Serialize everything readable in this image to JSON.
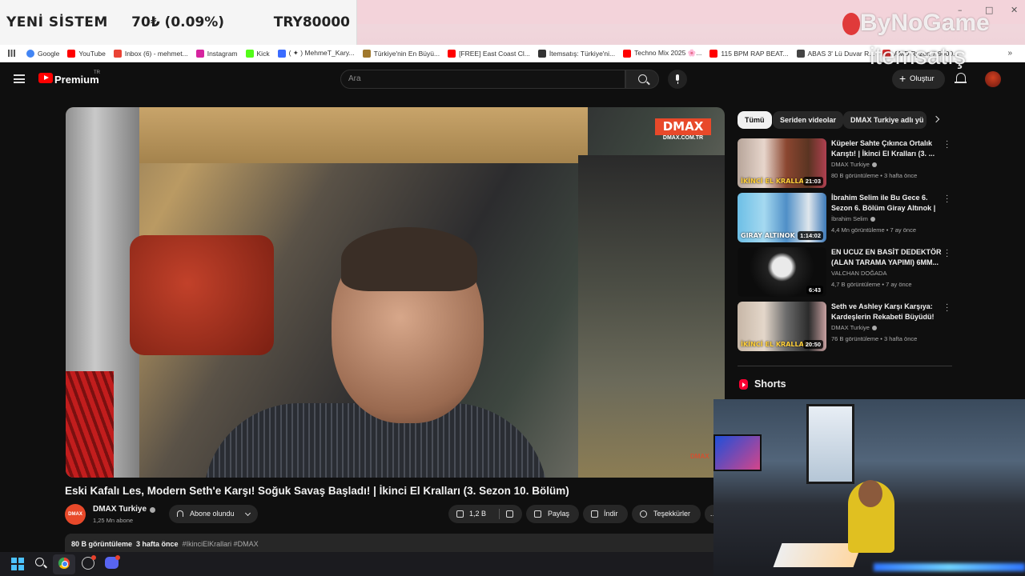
{
  "overlay_banner": {
    "title": "YENİ SİSTEM",
    "price": "70₺ (0.09%)",
    "symbol": "TRY80000"
  },
  "browser": {
    "window_controls": [
      "–",
      "□",
      "✕"
    ],
    "bookmarks": [
      {
        "label": "Google",
        "icon": "google-icon",
        "color": "#4285f4"
      },
      {
        "label": "YouTube",
        "icon": "youtube-icon",
        "color": "#ff0000"
      },
      {
        "label": "Inbox (6) - mehmet...",
        "icon": "gmail-icon",
        "color": "#ea4335"
      },
      {
        "label": "Instagram",
        "icon": "instagram-icon",
        "color": "#d6249f"
      },
      {
        "label": "Kick",
        "icon": "kick-icon",
        "color": "#53fc18"
      },
      {
        "label": "( ✦ ) MehmeT_Kary...",
        "icon": "bookmark-icon",
        "color": "#3b6cff"
      },
      {
        "label": "Türkiye'nin En Büyü...",
        "icon": "bookmark-icon",
        "color": "#a0782c"
      },
      {
        "label": "[FREE] East Coast Cl...",
        "icon": "youtube-icon",
        "color": "#ff0000"
      },
      {
        "label": "İtemsatış: Türkiye'ni...",
        "icon": "bookmark-icon",
        "color": "#333333"
      },
      {
        "label": "Techno Mix 2025 🌸...",
        "icon": "youtube-icon",
        "color": "#ff0000"
      },
      {
        "label": "115 BPM RAP BEAT...",
        "icon": "youtube-icon",
        "color": "#ff0000"
      },
      {
        "label": "ABAS 3' Lü Duvar R...",
        "icon": "bookmark-icon",
        "color": "#444444"
      },
      {
        "label": "AMD Ryzen 7 9000...",
        "icon": "amd-icon",
        "color": "#e03030"
      }
    ],
    "more_bookmarks": "»"
  },
  "watermark": {
    "line1": "ByNoGame",
    "line2": "itemsatış"
  },
  "header": {
    "brand": "Premium",
    "region": "TR",
    "search_placeholder": "Ara",
    "create_label": "Oluştur"
  },
  "player": {
    "badge_title": "DMAX",
    "badge_sub": "DMAX.COM.TR",
    "corner_mark": "DMAX"
  },
  "video": {
    "title": "Eski Kafalı Les, Modern Seth'e Karşı! Soğuk Savaş Başladı! | İkinci El Kralları (3. Sezon 10. Bölüm)",
    "channel": "DMAX Turkiye",
    "channel_avatar_text": "DMAX",
    "subscribers": "1,25 Mn abone",
    "subscribe_label": "Abone olundu",
    "likes": "1,2 B",
    "share_label": "Paylaş",
    "download_label": "İndir",
    "thanks_label": "Teşekkürler",
    "more_label": "…",
    "views": "80 B görüntüleme",
    "age": "3 hafta önce",
    "hashtags": "#IkinciElKrallari #DMAX"
  },
  "chips": [
    "Tümü",
    "Seriden videolar",
    "DMAX Turkiye adlı yü"
  ],
  "recommendations": [
    {
      "title": "Küpeler Sahte Çıkınca Ortalık Karıştı! | İkinci El Kralları (3. ...",
      "channel": "DMAX Turkiye",
      "meta": "80 B görüntüleme • 3 hafta önce",
      "duration": "21:03",
      "caption": "İKİNCİ EL KRALLARI"
    },
    {
      "title": "İbrahim Selim ile Bu Gece 6. Sezon 6. Bölüm Giray Altınok | ...",
      "channel": "İbrahim Selim",
      "meta": "4,4 Mn görüntüleme • 7 ay önce",
      "duration": "1:14:02",
      "caption": "GIRAY ALTINOK"
    },
    {
      "title": "EN UCUZ EN BASİT DEDEKTÖR (ALAN TARAMA YAPIMI) 6MM...",
      "channel": "VALCHAN DOĞADA",
      "meta": "4,7 B görüntüleme • 7 ay önce",
      "duration": "6:43",
      "caption": ""
    },
    {
      "title": "Seth ve Ashley Karşı Karşıya: Kardeşlerin Rekabeti Büyüdü! |...",
      "channel": "DMAX Turkiye",
      "meta": "76 B görüntüleme • 3 hafta önce",
      "duration": "20:50",
      "caption": "İKİNCİ EL KRALLARI"
    }
  ],
  "shorts_label": "Shorts"
}
